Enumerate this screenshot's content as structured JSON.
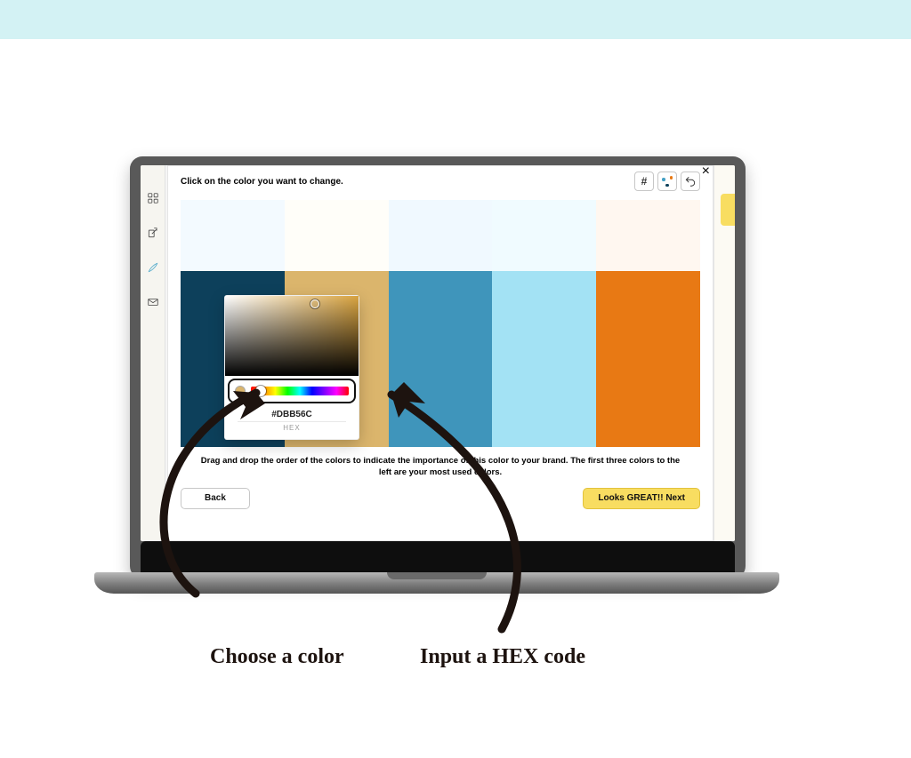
{
  "header": {
    "instruction": "Click on the color you want to change."
  },
  "tools": {
    "hash_label": "#"
  },
  "palette": {
    "light": [
      "#f3faff",
      "#fffef9",
      "#f0f9ff",
      "#f0fbff",
      "#fff7f0"
    ],
    "colors": [
      "#0d405b",
      "#dbb56c",
      "#3f95bb",
      "#a3e2f4",
      "#e87914"
    ]
  },
  "picker": {
    "hex_value": "#DBB56C",
    "hex_label": "HEX",
    "preview_color": "#dbb56c"
  },
  "footer": {
    "drag_text": "Drag and drop the order of the colors to indicate the importance of this color to your brand. The first three colors to the left are your most used colors.",
    "back_label": "Back",
    "next_label": "Looks GREAT!! Next"
  },
  "annotations": {
    "choose": "Choose a color",
    "hex": "Input a HEX code"
  }
}
